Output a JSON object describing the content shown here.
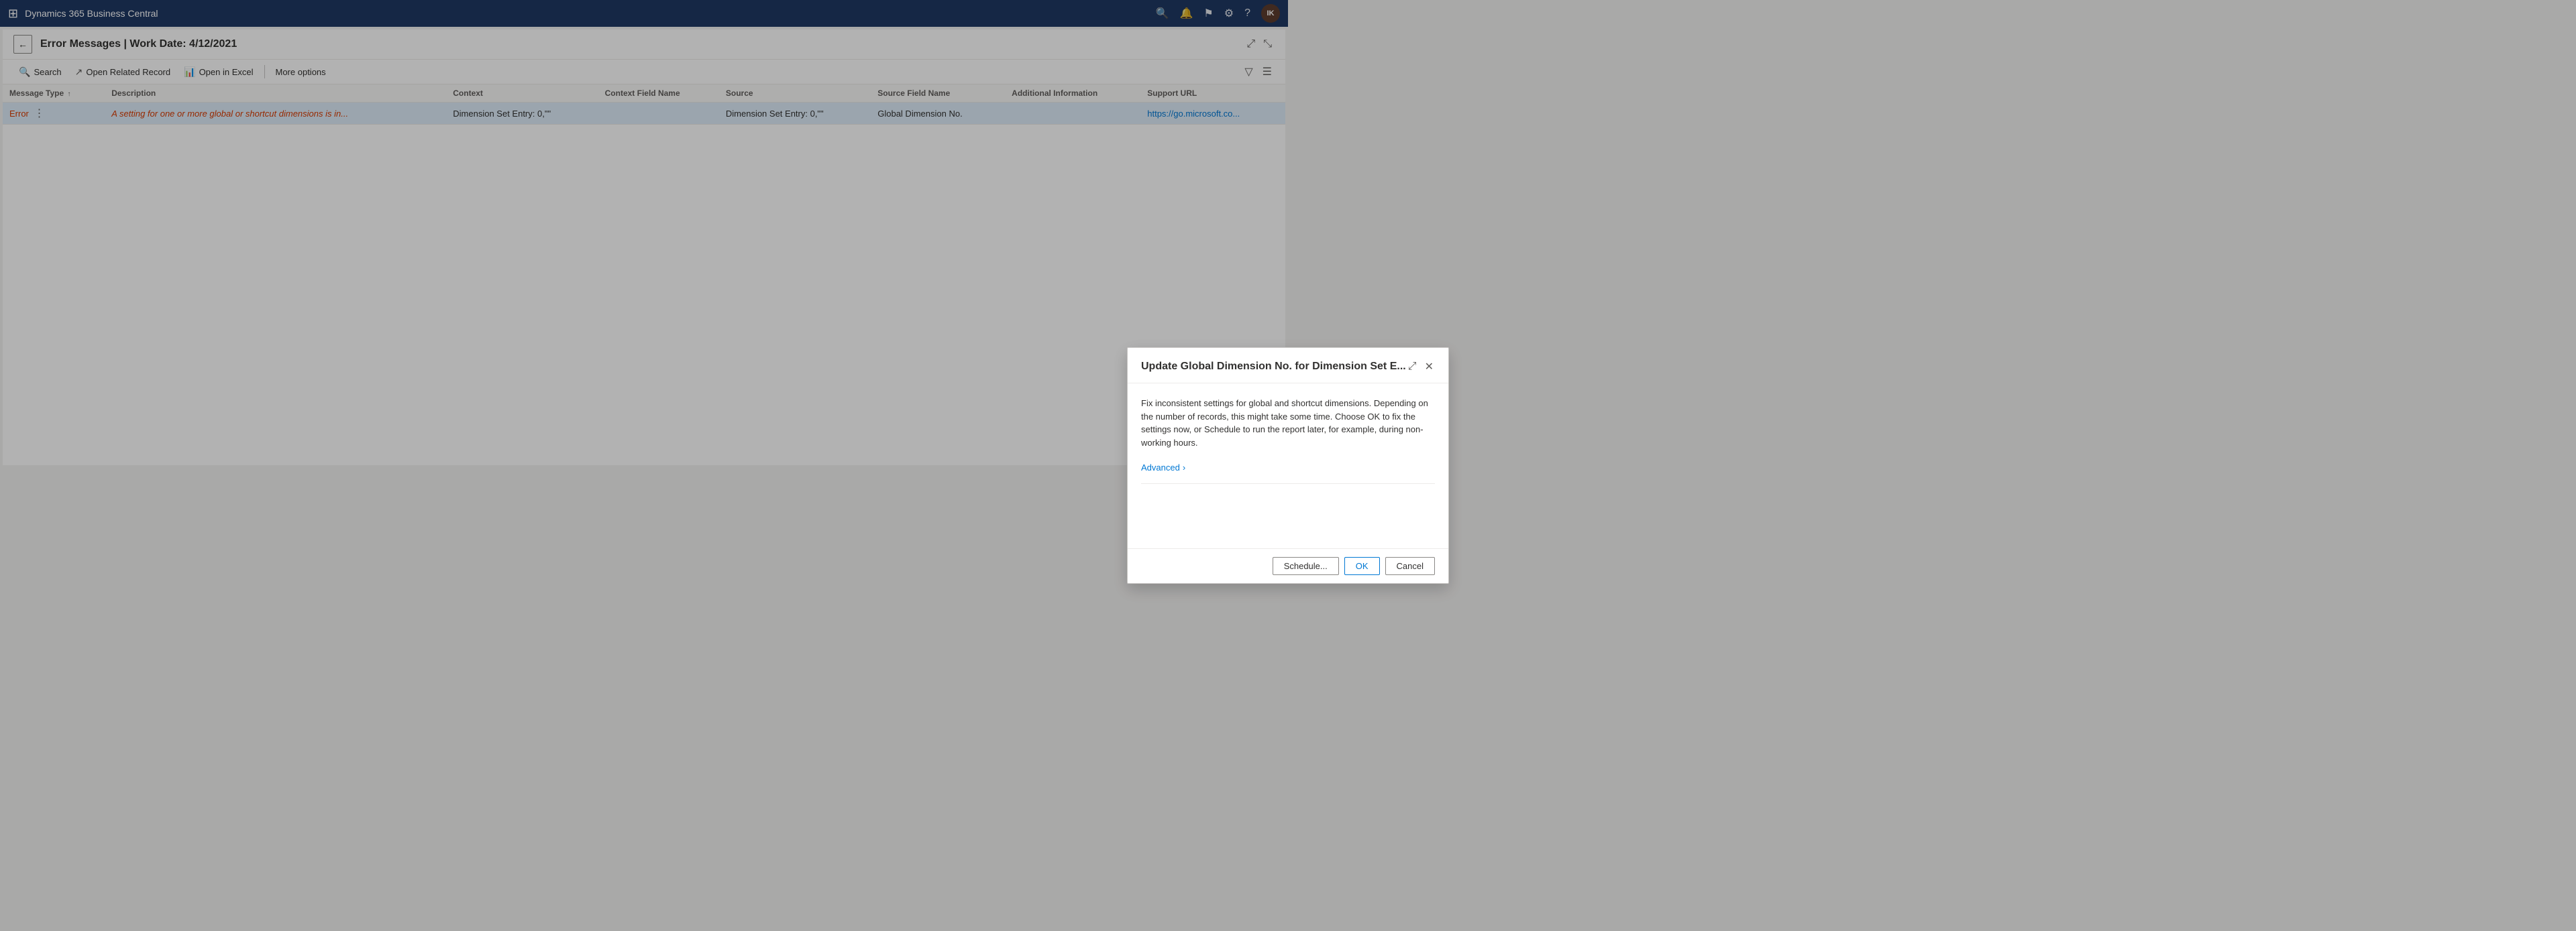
{
  "app": {
    "title": "Dynamics 365 Business Central"
  },
  "topbar": {
    "title": "Dynamics 365 Business Central",
    "avatar_initials": "IK"
  },
  "page": {
    "title": "Error Messages | Work Date: 4/12/2021",
    "back_label": "Back"
  },
  "toolbar": {
    "search_label": "Search",
    "open_related_label": "Open Related Record",
    "open_excel_label": "Open in Excel",
    "more_options_label": "More options"
  },
  "table": {
    "columns": [
      {
        "key": "message_type",
        "label": "Message Type",
        "sort": "asc"
      },
      {
        "key": "description",
        "label": "Description"
      },
      {
        "key": "context",
        "label": "Context"
      },
      {
        "key": "context_field_name",
        "label": "Context Field Name"
      },
      {
        "key": "source",
        "label": "Source"
      },
      {
        "key": "source_field_name",
        "label": "Source Field Name"
      },
      {
        "key": "additional_info",
        "label": "Additional Information"
      },
      {
        "key": "support_url",
        "label": "Support URL"
      }
    ],
    "rows": [
      {
        "message_type": "Error",
        "description": "A setting for one or more global or shortcut dimensions is in...",
        "context": "Dimension Set Entry: 0,\"\"",
        "context_field_name": "",
        "source": "Dimension Set Entry: 0,\"\"",
        "source_field_name": "Global Dimension No.",
        "additional_info": "",
        "support_url": "https://go.microsoft.co..."
      }
    ]
  },
  "modal": {
    "title": "Update Global Dimension No. for Dimension Set E...",
    "description": "Fix inconsistent settings for global and shortcut dimensions. Depending on the number of records, this might take some time. Choose OK to fix the settings now, or Schedule to run the report later, for example, during non-working hours.",
    "advanced_label": "Advanced",
    "chevron": "›",
    "schedule_label": "Schedule...",
    "ok_label": "OK",
    "cancel_label": "Cancel"
  },
  "icons": {
    "waffle": "⊞",
    "search": "🔍",
    "bell": "🔔",
    "flag": "⚑",
    "gear": "⚙",
    "help": "?",
    "back": "←",
    "expand": "⤢",
    "fullscreen": "⤡",
    "filter": "▽",
    "layout": "☰",
    "excel": "📊",
    "related": "↗",
    "expand_modal": "⤢",
    "close_modal": "✕",
    "chevron_right": "›",
    "ellipsis": "⋯"
  },
  "colors": {
    "nav_bg": "#1f3864",
    "accent_blue": "#0078d4",
    "error_red": "#d83b01",
    "selected_row_bg": "#deecf9",
    "table_header_bg": "#faf9f8"
  }
}
